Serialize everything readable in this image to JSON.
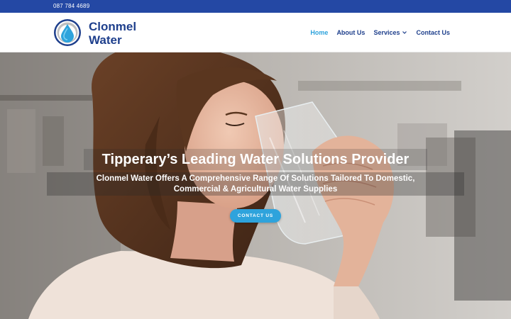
{
  "topbar": {
    "phone": "087 784 4689",
    "background": "#2448a4"
  },
  "header": {
    "brand_line1": "Clonmel",
    "brand_line2": "Water",
    "logo_icon": "water-drop-icon",
    "nav": [
      {
        "label": "Home",
        "active": true
      },
      {
        "label": "About Us",
        "active": false
      },
      {
        "label": "Services",
        "active": false,
        "dropdown": true
      },
      {
        "label": "Contact Us",
        "active": false
      }
    ]
  },
  "hero": {
    "headline": "Tipperary’s Leading Water Solutions Provider",
    "subline_1": "Clonmel Water Offers A Comprehensive Range Of Solutions Tailored To Domestic,",
    "subline_2": "Commercial & Agricultural Water Supplies",
    "cta_label": "CONTACT US"
  },
  "colors": {
    "brand_navy": "#1e3f8c",
    "accent_blue": "#2ea3dc",
    "topbar_blue": "#2448a4"
  }
}
